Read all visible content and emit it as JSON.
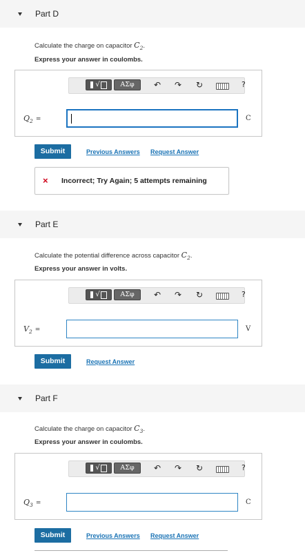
{
  "toolbar": {
    "greek_label": "ΑΣφ",
    "undo_icon": "undo-icon",
    "redo_icon": "redo-icon",
    "reset_icon": "reset-icon",
    "keyboard_icon": "keyboard-icon",
    "help_label": "?"
  },
  "partD": {
    "title": "Part D",
    "question_prefix": "Calculate the charge on capacitor ",
    "question_var": "C",
    "question_sub": "2",
    "question_suffix": ".",
    "instruction": "Express your answer in coulombs.",
    "var": "Q",
    "var_sub": "2",
    "equals": "=",
    "value": "",
    "unit": "C",
    "submit_label": "Submit",
    "previous_answers_label": "Previous Answers",
    "request_answer_label": "Request Answer",
    "feedback_icon": "×",
    "feedback_text": "Incorrect; Try Again; 5 attempts remaining"
  },
  "partE": {
    "title": "Part E",
    "question_prefix": "Calculate the potential difference across capacitor ",
    "question_var": "C",
    "question_sub": "2",
    "question_suffix": ".",
    "instruction": "Express your answer in volts.",
    "var": "V",
    "var_sub": "2",
    "equals": "=",
    "value": "",
    "unit": "V",
    "submit_label": "Submit",
    "request_answer_label": "Request Answer"
  },
  "partF": {
    "title": "Part F",
    "question_prefix": "Calculate the charge on capacitor ",
    "question_var": "C",
    "question_sub": "3",
    "question_suffix": ".",
    "instruction": "Express your answer in coulombs.",
    "var": "Q",
    "var_sub": "3",
    "equals": "=",
    "value": "",
    "unit": "C",
    "submit_label": "Submit",
    "previous_answers_label": "Previous Answers",
    "request_answer_label": "Request Answer"
  },
  "colors": {
    "submit_bg": "#1c6da2",
    "link": "#1a73b5",
    "input_border": "#2d84c4",
    "error": "#d0021b",
    "header_bg": "#f5f5f5"
  }
}
